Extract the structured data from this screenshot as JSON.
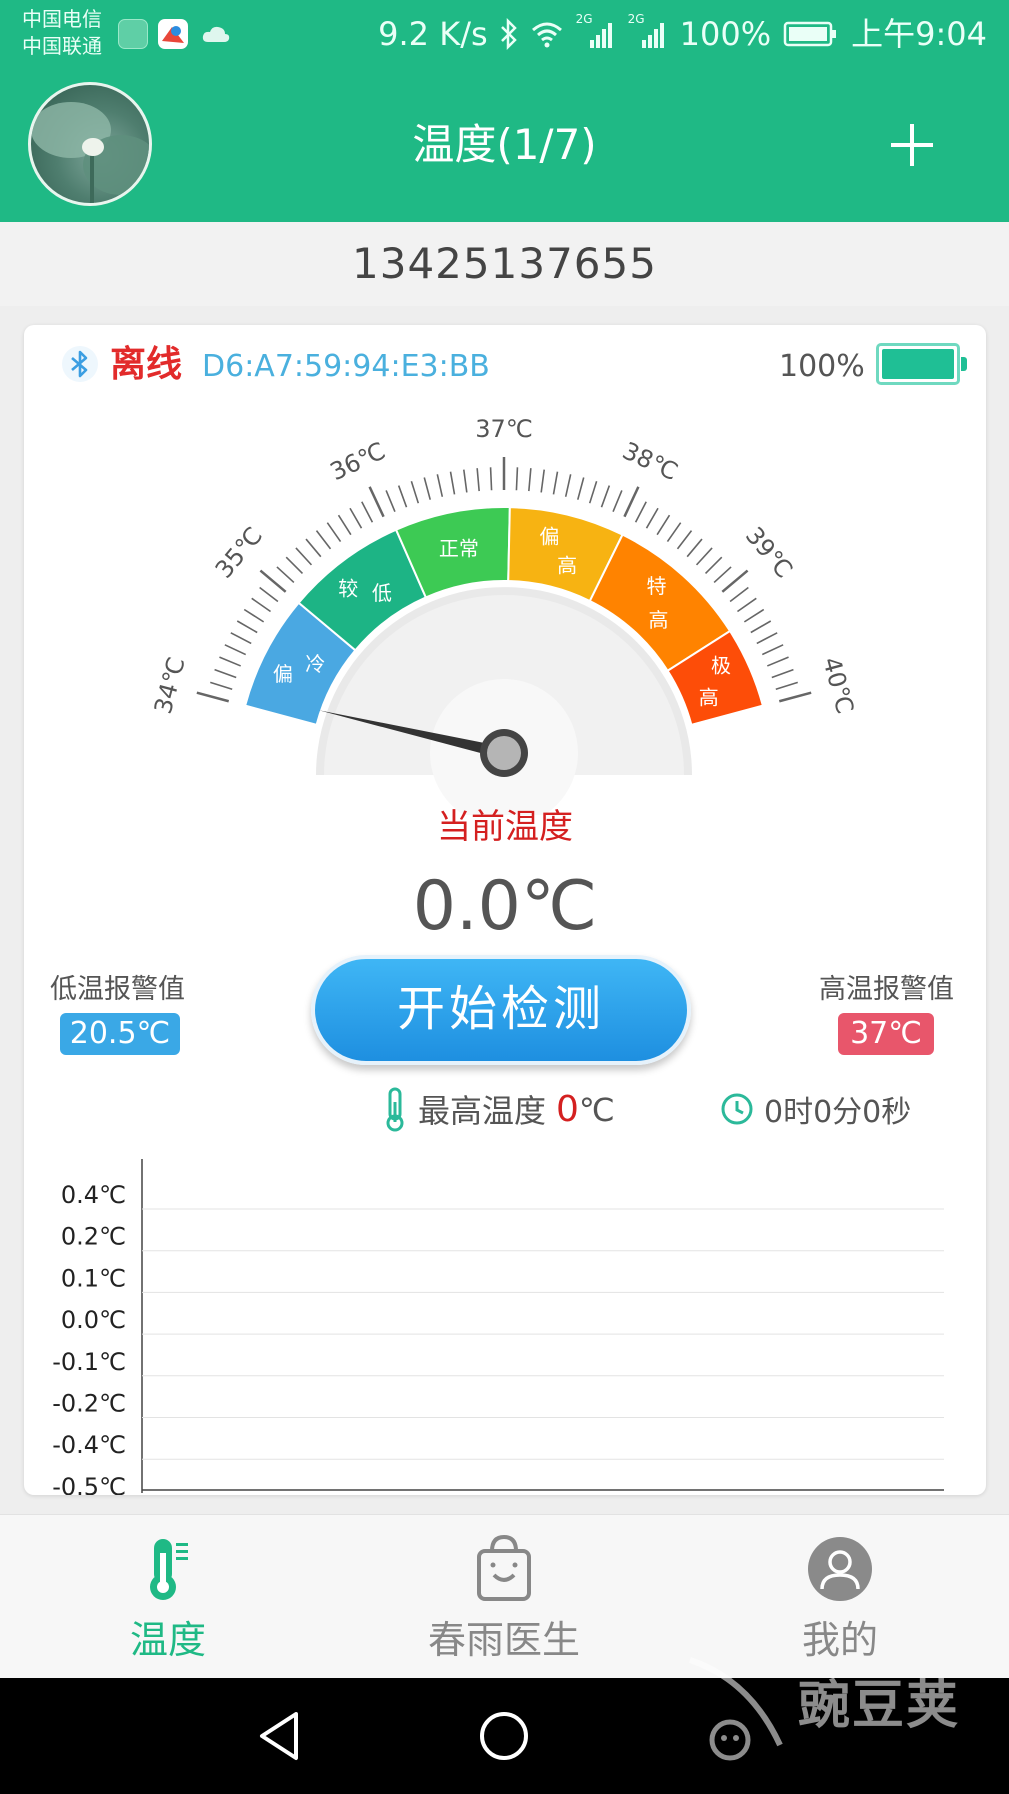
{
  "status_bar": {
    "carrier_1": "中国电信",
    "carrier_2": "中国联通",
    "net_speed": "9.2 K/s",
    "signal_1_label": "2G",
    "signal_2_label": "2G",
    "battery": "100%",
    "time": "上午9:04"
  },
  "header": {
    "title": "温度(1/7)",
    "add_icon": "plus-icon"
  },
  "phone_number": "13425137655",
  "device": {
    "connection_status": "离线",
    "mac_address": "D6:A7:59:94:E3:BB",
    "battery_percent": "100%",
    "battery_level": 1.0
  },
  "gauge": {
    "ticks": [
      "34℃",
      "35℃",
      "36℃",
      "37℃",
      "38℃",
      "39℃",
      "40℃"
    ],
    "zones": [
      {
        "label_1": "偏",
        "label_2": "冷",
        "color": "#4aa8e2"
      },
      {
        "label_1": "较",
        "label_2": "低",
        "color": "#1db485"
      },
      {
        "label_1": "正常",
        "label_2": "",
        "color": "#3dca54"
      },
      {
        "label_1": "偏",
        "label_2": "高",
        "color": "#f7b312"
      },
      {
        "label_1": "特",
        "label_2": "高",
        "color": "#ff8300"
      },
      {
        "label_1": "极",
        "label_2": "高",
        "color": "#fd4d08"
      }
    ],
    "needle_value": 0.0
  },
  "current": {
    "label": "当前温度",
    "value": "0.0℃"
  },
  "alarm": {
    "low_label": "低温报警值",
    "low_value": "20.5℃",
    "high_label": "高温报警值",
    "high_value": "37℃",
    "low_color": "#3aa8e6",
    "high_color": "#e8566b"
  },
  "start_button": "开始检测",
  "stats": {
    "max_label": "最高温度",
    "max_value": "0",
    "max_unit": "℃",
    "duration": "0时0分0秒"
  },
  "chart_data": {
    "type": "line",
    "y_tick_labels": [
      "0.4℃",
      "0.2℃",
      "0.1℃",
      "0.0℃",
      "-0.1℃",
      "-0.2℃",
      "-0.4℃",
      "-0.5℃"
    ],
    "series": [],
    "grid": true
  },
  "bottom_nav": {
    "items": [
      {
        "label": "温度",
        "icon": "thermometer-icon",
        "active": true
      },
      {
        "label": "春雨医生",
        "icon": "bag-icon",
        "active": false
      },
      {
        "label": "我的",
        "icon": "profile-icon",
        "active": false
      }
    ],
    "active_color": "#1fb985",
    "inactive_color": "#888888"
  },
  "watermark": "豌豆荚"
}
